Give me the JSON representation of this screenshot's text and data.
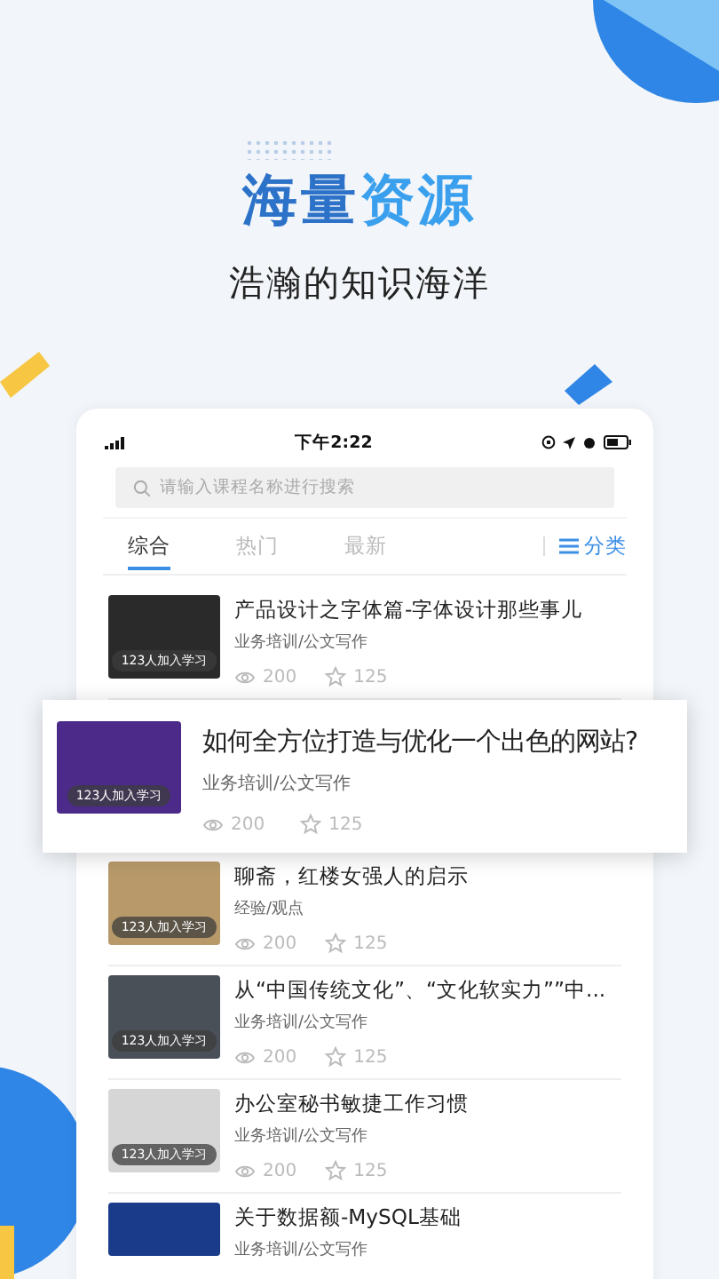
{
  "heading": {
    "parts": [
      {
        "text": "海量",
        "accent": false
      },
      {
        "text": "资源",
        "accent": true
      }
    ]
  },
  "subheading": "浩瀚的知识海洋",
  "status_bar": {
    "time": "下午2:22"
  },
  "search": {
    "placeholder": "请输入课程名称进行搜索"
  },
  "tabs": [
    {
      "label": "综合",
      "selected": true
    },
    {
      "label": "热门",
      "selected": false
    },
    {
      "label": "最新",
      "selected": false
    }
  ],
  "category_button": "分类",
  "courses": [
    {
      "title": "产品设计之字体篇-字体设计那些事儿",
      "category": "业务培训/公文写作",
      "learners": "123人加入学习",
      "views": "200",
      "stars_count": "125",
      "highlighted": false
    },
    {
      "title": "如何全方位打造与优化一个出色的网站?",
      "category": "业务培训/公文写作",
      "learners": "123人加入学习",
      "views": "200",
      "stars_count": "125",
      "highlighted": true
    },
    {
      "title": "聊斋，红楼女强人的启示",
      "category": "经验/观点",
      "learners": "123人加入学习",
      "views": "200",
      "stars_count": "125",
      "highlighted": false
    },
    {
      "title": "从“中国传统文化”、“文化软实力””中...",
      "category": "业务培训/公文写作",
      "learners": "123人加入学习",
      "views": "200",
      "stars_count": "125",
      "highlighted": false
    },
    {
      "title": "办公室秘书敏捷工作习惯",
      "category": "业务培训/公文写作",
      "learners": "123人加入学习",
      "views": "200",
      "stars_count": "125",
      "highlighted": false
    },
    {
      "title": "关于数据额-MySQL基础",
      "category": "业务培训/公文写作",
      "highlighted": false
    }
  ]
}
